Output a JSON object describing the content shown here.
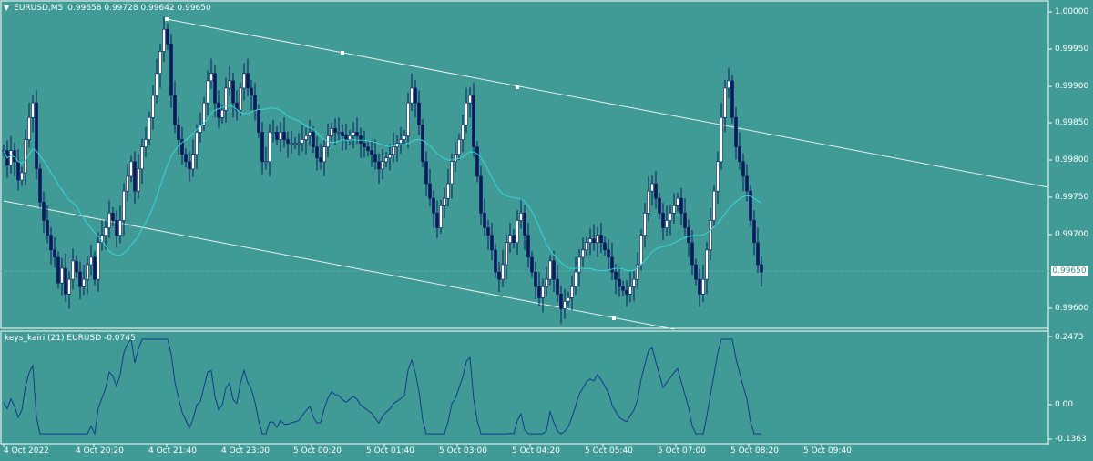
{
  "header": {
    "menu_icon": "triangle-down-icon",
    "symbol": "EURUSD,M5",
    "quotes": "0.99658 0.99728 0.99642 0.99650"
  },
  "price_axis": {
    "labels": [
      "1.00000",
      "0.99950",
      "0.99900",
      "0.99850",
      "0.99800",
      "0.99750",
      "0.99700",
      "0.99650",
      "0.99600"
    ],
    "current_price": "0.99650"
  },
  "indicator": {
    "title": "keys_kairi (21) EURUSD -0.0745",
    "axis_labels": [
      "0.2473",
      "0.00",
      "-0.1363"
    ]
  },
  "time_axis": {
    "labels": [
      "4 Oct 2022",
      "4 Oct 20:20",
      "4 Oct 21:40",
      "4 Oct 23:00",
      "5 Oct 00:20",
      "5 Oct 01:40",
      "5 Oct 03:00",
      "5 Oct 04:20",
      "5 Oct 05:40",
      "5 Oct 07:00",
      "5 Oct 08:20",
      "5 Oct 09:40"
    ]
  },
  "colors": {
    "background": "#409b96",
    "bull_candle": "#ffffff",
    "bear_candle": "#0b1a5c",
    "moving_average": "#39d3dc",
    "oscillator": "#143a8a",
    "grid_frame": "#ffffff"
  },
  "chart_data": {
    "type": "candlestick",
    "symbol": "EURUSD",
    "timeframe": "M5",
    "ylim": [
      0.99587,
      1.0001
    ],
    "channel": {
      "upper": [
        [
          "4 Oct 21:40",
          0.9999
        ],
        [
          "5 Oct 04:20",
          0.999
        ]
      ],
      "lower": [
        [
          "4 Oct 2022",
          0.99745
        ],
        [
          "5 Oct 05:40",
          0.9959
        ]
      ]
    },
    "ma_period": 21,
    "oscillator": {
      "name": "keys_kairi (21)",
      "last": -0.0745,
      "ylim": [
        -0.1363,
        0.2473
      ]
    }
  }
}
